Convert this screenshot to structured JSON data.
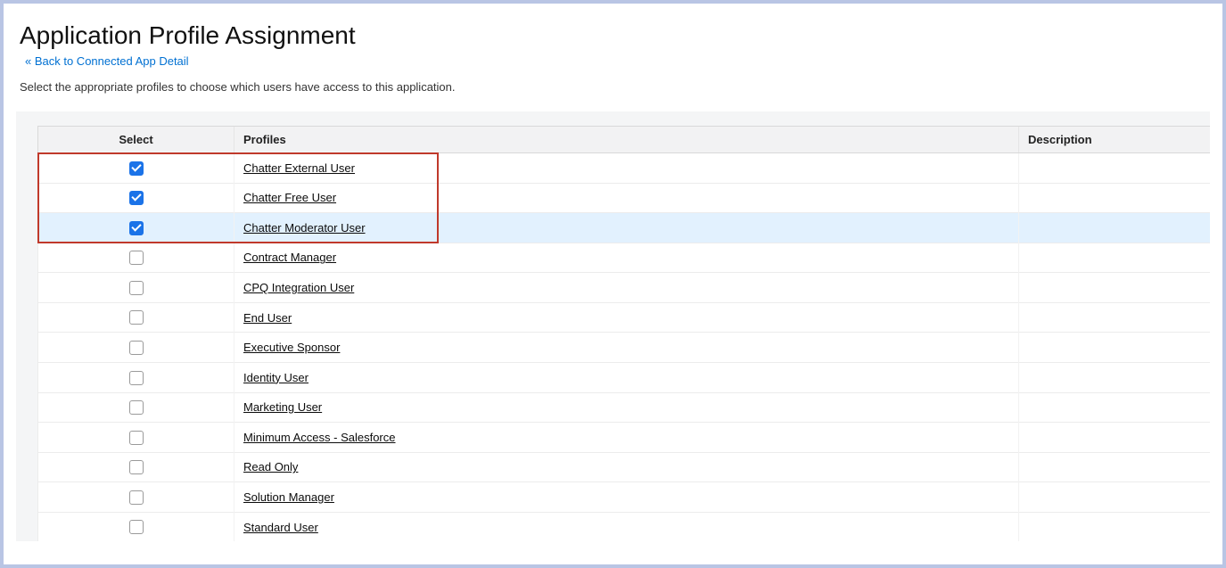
{
  "page_title": "Application Profile Assignment",
  "back_link_label": "« Back to Connected App Detail",
  "instruction_text": "Select the appropriate profiles to choose which users have access to this application.",
  "table": {
    "headers": {
      "select": "Select",
      "profiles": "Profiles",
      "description": "Description"
    },
    "rows": [
      {
        "checked": true,
        "profile": "Chatter External User",
        "description": "",
        "highlight": false
      },
      {
        "checked": true,
        "profile": "Chatter Free User",
        "description": "",
        "highlight": false
      },
      {
        "checked": true,
        "profile": "Chatter Moderator User",
        "description": "",
        "highlight": true
      },
      {
        "checked": false,
        "profile": "Contract Manager",
        "description": "",
        "highlight": false
      },
      {
        "checked": false,
        "profile": "CPQ Integration User",
        "description": "",
        "highlight": false
      },
      {
        "checked": false,
        "profile": "End User",
        "description": "",
        "highlight": false
      },
      {
        "checked": false,
        "profile": "Executive Sponsor",
        "description": "",
        "highlight": false
      },
      {
        "checked": false,
        "profile": "Identity User",
        "description": "",
        "highlight": false
      },
      {
        "checked": false,
        "profile": "Marketing User",
        "description": "",
        "highlight": false
      },
      {
        "checked": false,
        "profile": "Minimum Access - Salesforce",
        "description": "",
        "highlight": false
      },
      {
        "checked": false,
        "profile": "Read Only",
        "description": "",
        "highlight": false
      },
      {
        "checked": false,
        "profile": "Solution Manager",
        "description": "",
        "highlight": false
      },
      {
        "checked": false,
        "profile": "Standard User",
        "description": "",
        "highlight": false
      }
    ]
  },
  "callout": {
    "rows_covered": 3
  }
}
